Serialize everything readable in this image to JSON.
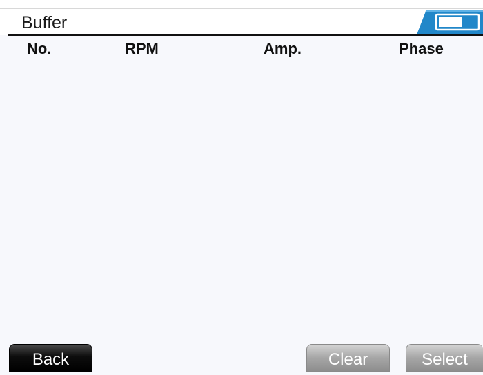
{
  "header": {
    "title": "Buffer",
    "status_icon": "battery-icon",
    "accent_color": "#2187c9"
  },
  "table": {
    "columns": [
      "No.",
      "RPM",
      "Amp.",
      "Phase"
    ],
    "rows": []
  },
  "footer": {
    "back_label": "Back",
    "clear_label": "Clear",
    "select_label": "Select"
  }
}
